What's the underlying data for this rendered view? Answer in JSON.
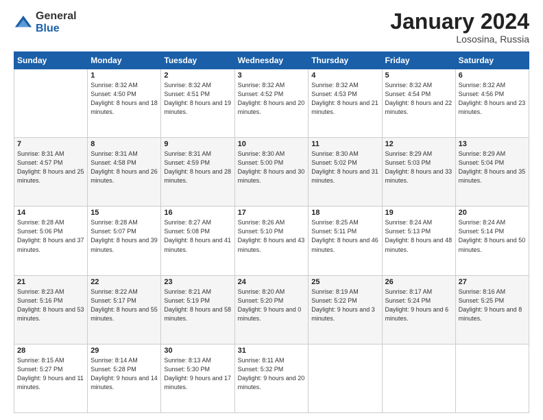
{
  "logo": {
    "general": "General",
    "blue": "Blue"
  },
  "header": {
    "month_year": "January 2024",
    "location": "Lososina, Russia"
  },
  "days_of_week": [
    "Sunday",
    "Monday",
    "Tuesday",
    "Wednesday",
    "Thursday",
    "Friday",
    "Saturday"
  ],
  "weeks": [
    [
      {
        "day": "",
        "sunrise": "",
        "sunset": "",
        "daylight": ""
      },
      {
        "day": "1",
        "sunrise": "Sunrise: 8:32 AM",
        "sunset": "Sunset: 4:50 PM",
        "daylight": "Daylight: 8 hours and 18 minutes."
      },
      {
        "day": "2",
        "sunrise": "Sunrise: 8:32 AM",
        "sunset": "Sunset: 4:51 PM",
        "daylight": "Daylight: 8 hours and 19 minutes."
      },
      {
        "day": "3",
        "sunrise": "Sunrise: 8:32 AM",
        "sunset": "Sunset: 4:52 PM",
        "daylight": "Daylight: 8 hours and 20 minutes."
      },
      {
        "day": "4",
        "sunrise": "Sunrise: 8:32 AM",
        "sunset": "Sunset: 4:53 PM",
        "daylight": "Daylight: 8 hours and 21 minutes."
      },
      {
        "day": "5",
        "sunrise": "Sunrise: 8:32 AM",
        "sunset": "Sunset: 4:54 PM",
        "daylight": "Daylight: 8 hours and 22 minutes."
      },
      {
        "day": "6",
        "sunrise": "Sunrise: 8:32 AM",
        "sunset": "Sunset: 4:56 PM",
        "daylight": "Daylight: 8 hours and 23 minutes."
      }
    ],
    [
      {
        "day": "7",
        "sunrise": "Sunrise: 8:31 AM",
        "sunset": "Sunset: 4:57 PM",
        "daylight": "Daylight: 8 hours and 25 minutes."
      },
      {
        "day": "8",
        "sunrise": "Sunrise: 8:31 AM",
        "sunset": "Sunset: 4:58 PM",
        "daylight": "Daylight: 8 hours and 26 minutes."
      },
      {
        "day": "9",
        "sunrise": "Sunrise: 8:31 AM",
        "sunset": "Sunset: 4:59 PM",
        "daylight": "Daylight: 8 hours and 28 minutes."
      },
      {
        "day": "10",
        "sunrise": "Sunrise: 8:30 AM",
        "sunset": "Sunset: 5:00 PM",
        "daylight": "Daylight: 8 hours and 30 minutes."
      },
      {
        "day": "11",
        "sunrise": "Sunrise: 8:30 AM",
        "sunset": "Sunset: 5:02 PM",
        "daylight": "Daylight: 8 hours and 31 minutes."
      },
      {
        "day": "12",
        "sunrise": "Sunrise: 8:29 AM",
        "sunset": "Sunset: 5:03 PM",
        "daylight": "Daylight: 8 hours and 33 minutes."
      },
      {
        "day": "13",
        "sunrise": "Sunrise: 8:29 AM",
        "sunset": "Sunset: 5:04 PM",
        "daylight": "Daylight: 8 hours and 35 minutes."
      }
    ],
    [
      {
        "day": "14",
        "sunrise": "Sunrise: 8:28 AM",
        "sunset": "Sunset: 5:06 PM",
        "daylight": "Daylight: 8 hours and 37 minutes."
      },
      {
        "day": "15",
        "sunrise": "Sunrise: 8:28 AM",
        "sunset": "Sunset: 5:07 PM",
        "daylight": "Daylight: 8 hours and 39 minutes."
      },
      {
        "day": "16",
        "sunrise": "Sunrise: 8:27 AM",
        "sunset": "Sunset: 5:08 PM",
        "daylight": "Daylight: 8 hours and 41 minutes."
      },
      {
        "day": "17",
        "sunrise": "Sunrise: 8:26 AM",
        "sunset": "Sunset: 5:10 PM",
        "daylight": "Daylight: 8 hours and 43 minutes."
      },
      {
        "day": "18",
        "sunrise": "Sunrise: 8:25 AM",
        "sunset": "Sunset: 5:11 PM",
        "daylight": "Daylight: 8 hours and 46 minutes."
      },
      {
        "day": "19",
        "sunrise": "Sunrise: 8:24 AM",
        "sunset": "Sunset: 5:13 PM",
        "daylight": "Daylight: 8 hours and 48 minutes."
      },
      {
        "day": "20",
        "sunrise": "Sunrise: 8:24 AM",
        "sunset": "Sunset: 5:14 PM",
        "daylight": "Daylight: 8 hours and 50 minutes."
      }
    ],
    [
      {
        "day": "21",
        "sunrise": "Sunrise: 8:23 AM",
        "sunset": "Sunset: 5:16 PM",
        "daylight": "Daylight: 8 hours and 53 minutes."
      },
      {
        "day": "22",
        "sunrise": "Sunrise: 8:22 AM",
        "sunset": "Sunset: 5:17 PM",
        "daylight": "Daylight: 8 hours and 55 minutes."
      },
      {
        "day": "23",
        "sunrise": "Sunrise: 8:21 AM",
        "sunset": "Sunset: 5:19 PM",
        "daylight": "Daylight: 8 hours and 58 minutes."
      },
      {
        "day": "24",
        "sunrise": "Sunrise: 8:20 AM",
        "sunset": "Sunset: 5:20 PM",
        "daylight": "Daylight: 9 hours and 0 minutes."
      },
      {
        "day": "25",
        "sunrise": "Sunrise: 8:19 AM",
        "sunset": "Sunset: 5:22 PM",
        "daylight": "Daylight: 9 hours and 3 minutes."
      },
      {
        "day": "26",
        "sunrise": "Sunrise: 8:17 AM",
        "sunset": "Sunset: 5:24 PM",
        "daylight": "Daylight: 9 hours and 6 minutes."
      },
      {
        "day": "27",
        "sunrise": "Sunrise: 8:16 AM",
        "sunset": "Sunset: 5:25 PM",
        "daylight": "Daylight: 9 hours and 8 minutes."
      }
    ],
    [
      {
        "day": "28",
        "sunrise": "Sunrise: 8:15 AM",
        "sunset": "Sunset: 5:27 PM",
        "daylight": "Daylight: 9 hours and 11 minutes."
      },
      {
        "day": "29",
        "sunrise": "Sunrise: 8:14 AM",
        "sunset": "Sunset: 5:28 PM",
        "daylight": "Daylight: 9 hours and 14 minutes."
      },
      {
        "day": "30",
        "sunrise": "Sunrise: 8:13 AM",
        "sunset": "Sunset: 5:30 PM",
        "daylight": "Daylight: 9 hours and 17 minutes."
      },
      {
        "day": "31",
        "sunrise": "Sunrise: 8:11 AM",
        "sunset": "Sunset: 5:32 PM",
        "daylight": "Daylight: 9 hours and 20 minutes."
      },
      {
        "day": "",
        "sunrise": "",
        "sunset": "",
        "daylight": ""
      },
      {
        "day": "",
        "sunrise": "",
        "sunset": "",
        "daylight": ""
      },
      {
        "day": "",
        "sunrise": "",
        "sunset": "",
        "daylight": ""
      }
    ]
  ]
}
